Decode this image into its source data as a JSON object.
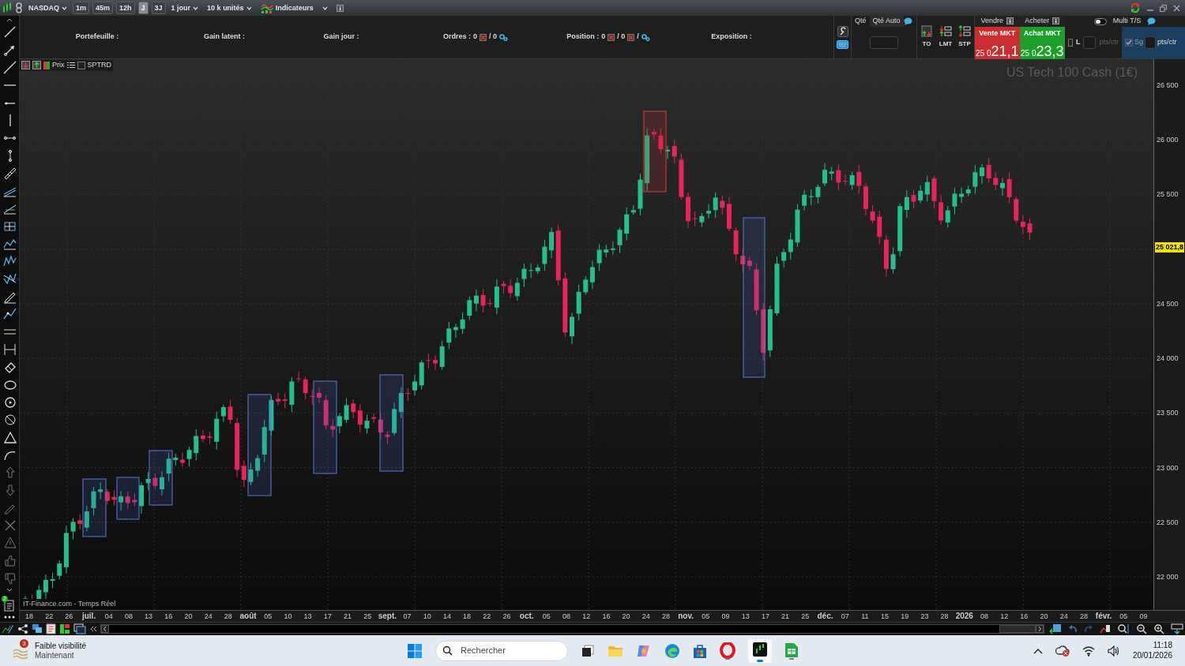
{
  "toolbar": {
    "symbol": "NASDAQ",
    "periods": [
      {
        "label": "1m",
        "selected": false
      },
      {
        "label": "45m",
        "selected": false
      },
      {
        "label": "12h",
        "selected": false
      },
      {
        "label": "J",
        "selected": true
      },
      {
        "label": "3J",
        "selected": false
      }
    ],
    "timeframe": "1 jour",
    "units": "10 k unités",
    "indicators": "Indicateurs"
  },
  "account_bar": {
    "portfolio": "Portefeuille :",
    "unrealized_gain": "Gain latent :",
    "day_gain": "Gain jour :",
    "orders": {
      "label": "Ordres :",
      "count": "0",
      "total": "/ 0"
    },
    "position": {
      "label": "Position :",
      "long": "0",
      "short": "/ 0",
      "separator": "/"
    },
    "exposure": "Exposition :"
  },
  "order_panel": {
    "qty_label": "Qté",
    "qty_auto": "Qté Auto",
    "order_types": [
      "TO",
      "LMT",
      "STP"
    ],
    "sell_header": "Vendre",
    "buy_header": "Acheter",
    "sell": {
      "label": "Vente MKT",
      "price_prefix": "25 0",
      "price": "21,1"
    },
    "buy": {
      "label": "Achat MKT",
      "price_prefix": "25 0",
      "price": "23,3"
    },
    "multi_ts": {
      "label": "Multi T/S",
      "on": false
    },
    "limit": {
      "label": "L",
      "checked": false,
      "unit": "pts/ctr"
    },
    "stop": {
      "label": "Sg",
      "checked": true,
      "unit": "pts/ctr"
    }
  },
  "tools_badge": "2",
  "chart": {
    "price_label": "Prix",
    "sptrd": {
      "label": "SPTRD",
      "checked": false
    },
    "watermark": "US Tech 100 Cash (1€)",
    "source": "IT-Finance.com - Temps Réel",
    "y_ticks": [
      "26 500",
      "26 000",
      "25 500",
      "24 500",
      "24 000",
      "23 500",
      "23 000",
      "22 500",
      "22 000"
    ],
    "last_price": "25 021,8",
    "dates": [
      {
        "label": "18",
        "kind": "day"
      },
      {
        "label": "22",
        "kind": "day"
      },
      {
        "label": "26",
        "kind": "day"
      },
      {
        "label": "juil.",
        "kind": "month"
      },
      {
        "label": "04",
        "kind": "day"
      },
      {
        "label": "08",
        "kind": "day"
      },
      {
        "label": "13",
        "kind": "day"
      },
      {
        "label": "16",
        "kind": "day"
      },
      {
        "label": "20",
        "kind": "day"
      },
      {
        "label": "24",
        "kind": "day"
      },
      {
        "label": "28",
        "kind": "day"
      },
      {
        "label": "août",
        "kind": "month"
      },
      {
        "label": "05",
        "kind": "day"
      },
      {
        "label": "10",
        "kind": "day"
      },
      {
        "label": "13",
        "kind": "day"
      },
      {
        "label": "17",
        "kind": "day"
      },
      {
        "label": "21",
        "kind": "day"
      },
      {
        "label": "25",
        "kind": "day"
      },
      {
        "label": "sept.",
        "kind": "month"
      },
      {
        "label": "07",
        "kind": "day"
      },
      {
        "label": "10",
        "kind": "day"
      },
      {
        "label": "14",
        "kind": "day"
      },
      {
        "label": "18",
        "kind": "day"
      },
      {
        "label": "22",
        "kind": "day"
      },
      {
        "label": "26",
        "kind": "day"
      },
      {
        "label": "oct.",
        "kind": "month"
      },
      {
        "label": "05",
        "kind": "day"
      },
      {
        "label": "08",
        "kind": "day"
      },
      {
        "label": "12",
        "kind": "day"
      },
      {
        "label": "16",
        "kind": "day"
      },
      {
        "label": "20",
        "kind": "day"
      },
      {
        "label": "24",
        "kind": "day"
      },
      {
        "label": "28",
        "kind": "day"
      },
      {
        "label": "nov.",
        "kind": "month"
      },
      {
        "label": "05",
        "kind": "day"
      },
      {
        "label": "09",
        "kind": "day"
      },
      {
        "label": "13",
        "kind": "day"
      },
      {
        "label": "17",
        "kind": "day"
      },
      {
        "label": "21",
        "kind": "day"
      },
      {
        "label": "25",
        "kind": "day"
      },
      {
        "label": "déc.",
        "kind": "month"
      },
      {
        "label": "07",
        "kind": "day"
      },
      {
        "label": "11",
        "kind": "day"
      },
      {
        "label": "15",
        "kind": "day"
      },
      {
        "label": "19",
        "kind": "day"
      },
      {
        "label": "23",
        "kind": "day"
      },
      {
        "label": "28",
        "kind": "day"
      },
      {
        "label": "2026",
        "kind": "month"
      },
      {
        "label": "08",
        "kind": "day"
      },
      {
        "label": "12",
        "kind": "day"
      },
      {
        "label": "16",
        "kind": "day"
      },
      {
        "label": "20",
        "kind": "day"
      },
      {
        "label": "24",
        "kind": "day"
      },
      {
        "label": "28",
        "kind": "day"
      },
      {
        "label": "févr.",
        "kind": "month"
      },
      {
        "label": "05",
        "kind": "day"
      },
      {
        "label": "09",
        "kind": "day"
      }
    ]
  },
  "taskbar": {
    "notification": {
      "badge": "3",
      "title": "Faible visibilité",
      "time": "Maintenant"
    },
    "search_placeholder": "Rechercher",
    "clock": {
      "time": "11:18",
      "date": "20/01/2026"
    }
  }
}
